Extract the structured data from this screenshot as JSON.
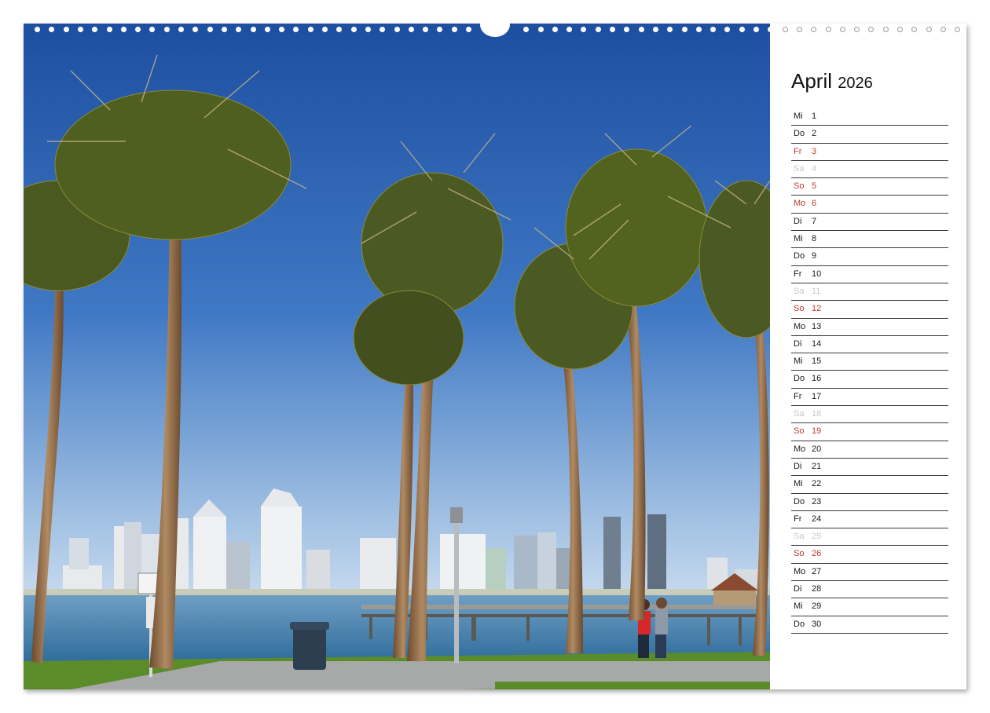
{
  "calendar": {
    "month": "April",
    "year": "2026",
    "days": [
      {
        "wd": "Mi",
        "d": "1",
        "type": "normal"
      },
      {
        "wd": "Do",
        "d": "2",
        "type": "normal"
      },
      {
        "wd": "Fr",
        "d": "3",
        "type": "holiday"
      },
      {
        "wd": "Sa",
        "d": "4",
        "type": "saturday"
      },
      {
        "wd": "So",
        "d": "5",
        "type": "holiday"
      },
      {
        "wd": "Mo",
        "d": "6",
        "type": "holiday"
      },
      {
        "wd": "Di",
        "d": "7",
        "type": "normal"
      },
      {
        "wd": "Mi",
        "d": "8",
        "type": "normal"
      },
      {
        "wd": "Do",
        "d": "9",
        "type": "normal"
      },
      {
        "wd": "Fr",
        "d": "10",
        "type": "normal"
      },
      {
        "wd": "Sa",
        "d": "11",
        "type": "saturday"
      },
      {
        "wd": "So",
        "d": "12",
        "type": "holiday"
      },
      {
        "wd": "Mo",
        "d": "13",
        "type": "normal"
      },
      {
        "wd": "Di",
        "d": "14",
        "type": "normal"
      },
      {
        "wd": "Mi",
        "d": "15",
        "type": "normal"
      },
      {
        "wd": "Do",
        "d": "16",
        "type": "normal"
      },
      {
        "wd": "Fr",
        "d": "17",
        "type": "normal"
      },
      {
        "wd": "Sa",
        "d": "18",
        "type": "saturday"
      },
      {
        "wd": "So",
        "d": "19",
        "type": "holiday"
      },
      {
        "wd": "Mo",
        "d": "20",
        "type": "normal"
      },
      {
        "wd": "Di",
        "d": "21",
        "type": "normal"
      },
      {
        "wd": "Mi",
        "d": "22",
        "type": "normal"
      },
      {
        "wd": "Do",
        "d": "23",
        "type": "normal"
      },
      {
        "wd": "Fr",
        "d": "24",
        "type": "normal"
      },
      {
        "wd": "Sa",
        "d": "25",
        "type": "saturday"
      },
      {
        "wd": "So",
        "d": "26",
        "type": "holiday"
      },
      {
        "wd": "Mo",
        "d": "27",
        "type": "normal"
      },
      {
        "wd": "Di",
        "d": "28",
        "type": "normal"
      },
      {
        "wd": "Mi",
        "d": "29",
        "type": "normal"
      },
      {
        "wd": "Do",
        "d": "30",
        "type": "normal"
      }
    ]
  },
  "colors": {
    "holiday": "#c0392b",
    "saturday": "#c8c8c8",
    "normal": "#1a1a1a"
  }
}
